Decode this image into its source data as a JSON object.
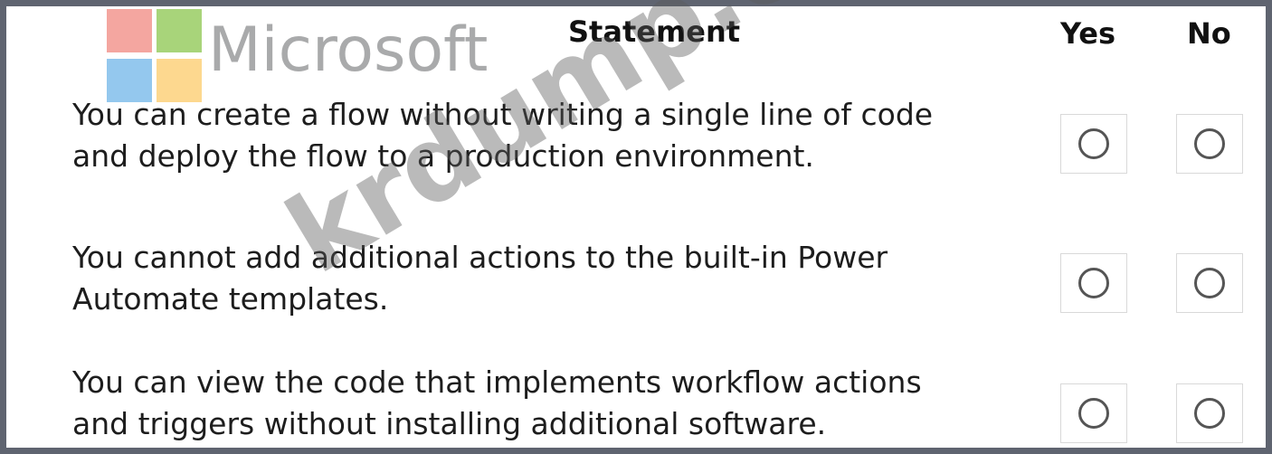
{
  "logo": {
    "wordmark": "Microsoft",
    "colors": [
      "#f4a6a0",
      "#a8d47a",
      "#94c8ee",
      "#fdd88f"
    ]
  },
  "table": {
    "headers": {
      "statement": "Statement",
      "yes": "Yes",
      "no": "No"
    },
    "rows": [
      {
        "line1": "You can create a flow without writing a single line of code",
        "line2": "and deploy the flow to a production environment."
      },
      {
        "line1": "You cannot add additional actions to the built-in Power",
        "line2": "Automate templates."
      },
      {
        "line1": "You can view the code that implements workflow actions",
        "line2": "and triggers without installing additional software."
      }
    ]
  },
  "watermark": "krdump.com",
  "icons": {
    "radio": "radio-button-unselected-icon"
  }
}
